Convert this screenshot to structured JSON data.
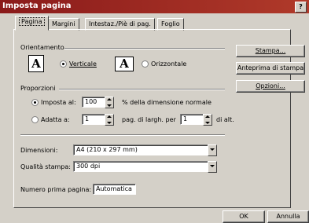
{
  "dialog": {
    "title": "Imposta pagina",
    "help": "?"
  },
  "tabs": [
    {
      "label": "Pagina"
    },
    {
      "label": "Margini"
    },
    {
      "label": "Intestaz./Piè di pag."
    },
    {
      "label": "Foglio"
    }
  ],
  "orientation": {
    "group_label": "Orientamento",
    "icon_letter": "A",
    "portrait_label": "Verticale",
    "landscape_label": "Orizzontale",
    "selected": "portrait"
  },
  "scaling": {
    "group_label": "Proporzioni",
    "adjust_label": "Imposta al:",
    "adjust_value": "100",
    "adjust_suffix": "% della dimensione normale",
    "fit_label": "Adatta a:",
    "fit_wide_value": "1",
    "fit_middle": "pag. di largh. per",
    "fit_tall_value": "1",
    "fit_suffix": "di alt.",
    "selected": "adjust"
  },
  "paper": {
    "label": "Dimensioni:",
    "value": "A4 (210 x 297 mm)"
  },
  "quality": {
    "label": "Qualità stampa:",
    "value": "300 dpi"
  },
  "first_page": {
    "label": "Numero prima pagina:",
    "value": "Automatica"
  },
  "side_buttons": {
    "print": "Stampa...",
    "preview": "Anteprima di stampa",
    "options": "Opzioni..."
  },
  "footer": {
    "ok": "OK",
    "cancel": "Annulla"
  }
}
